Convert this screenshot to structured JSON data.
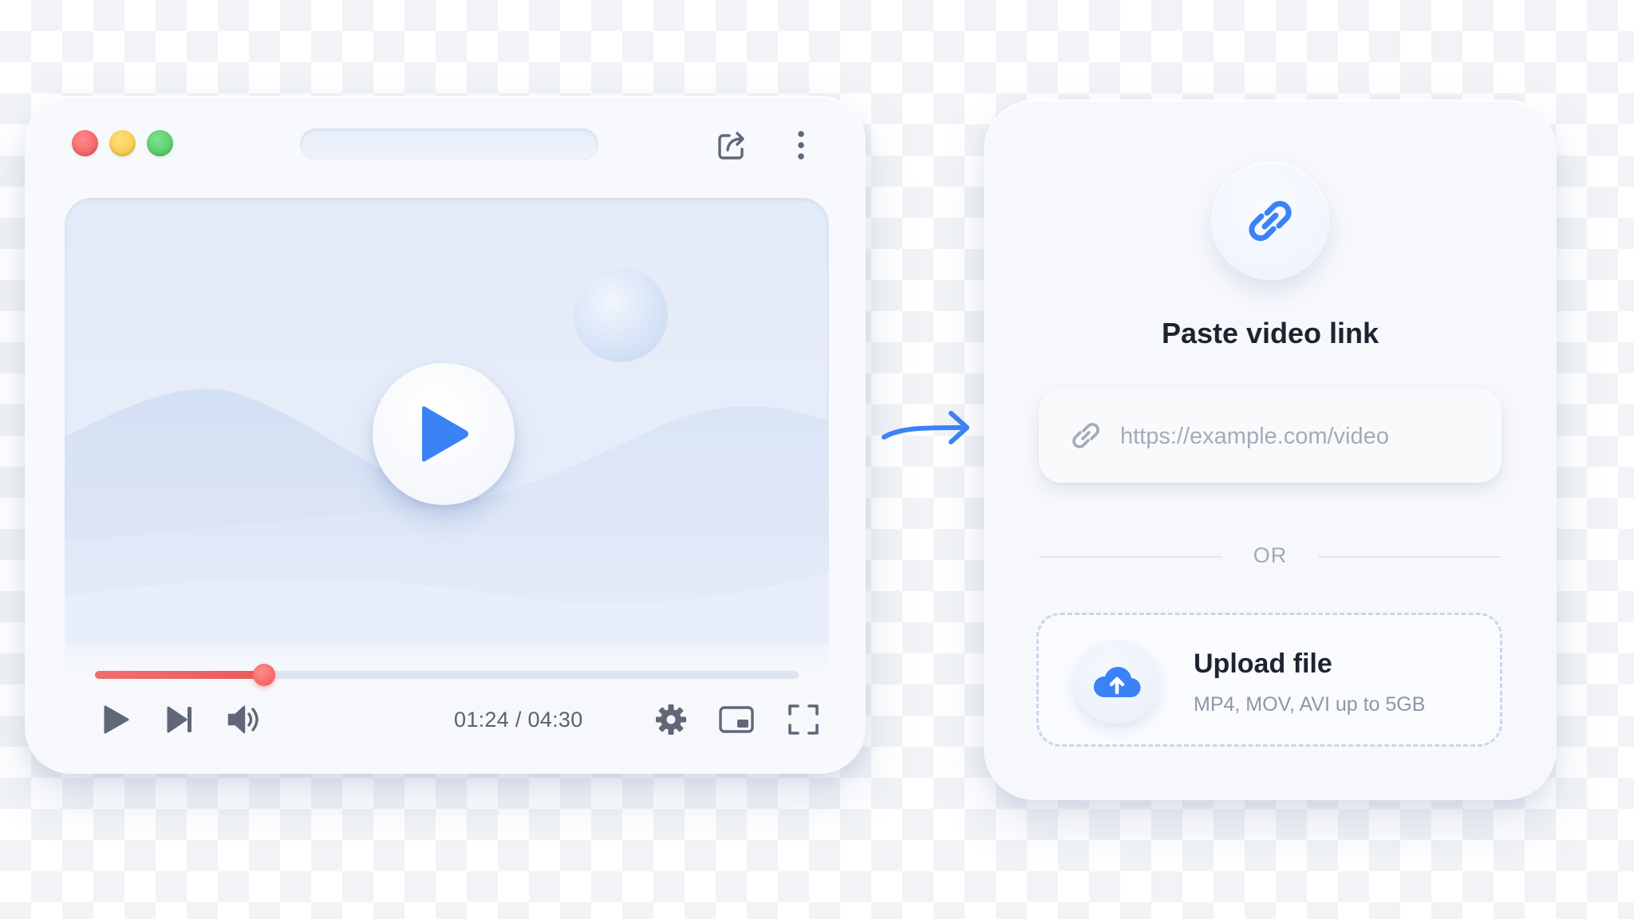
{
  "player": {
    "time_label": "01:24 / 04:30",
    "progress_fraction": 0.24,
    "icons": {
      "share": "share-icon",
      "menu": "kebab-menu-icon",
      "big_play": "play-icon",
      "play": "play-icon",
      "skip": "skip-next-icon",
      "volume": "volume-icon",
      "settings": "gear-icon",
      "miniplayer": "miniplayer-icon",
      "fullscreen": "fullscreen-icon"
    },
    "colors": {
      "progress": "#ee5a5a",
      "accent": "#3b82f6"
    }
  },
  "arrow": {
    "icon": "arrow-right-icon",
    "color": "#3b82f6"
  },
  "upload_panel": {
    "link_icon": "link-icon",
    "title": "Paste video link",
    "url_placeholder": "https://example.com/video",
    "divider_text": "OR",
    "upload": {
      "icon": "cloud-upload-icon",
      "title": "Upload file",
      "subtitle": "MP4, MOV, AVI up to 5GB"
    }
  }
}
